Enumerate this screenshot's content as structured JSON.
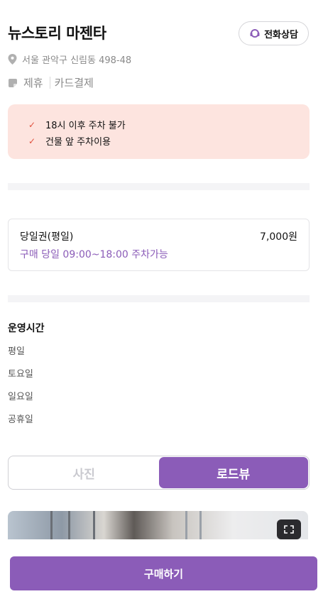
{
  "header": {
    "title": "뉴스토리 마젠타",
    "call_button_label": "전화상담"
  },
  "info": {
    "address": "서울 관악구 신림동 498-48",
    "tags": [
      "제휴",
      "카드결제"
    ]
  },
  "notice": {
    "items": [
      "18시 이후 주차 불가",
      "건물 앞 주차이용"
    ]
  },
  "ticket": {
    "name": "당일권(평일)",
    "price": "7,000원",
    "description": "구매 당일 09:00~18:00 주차가능"
  },
  "hours": {
    "title": "운영시간",
    "days": [
      "평일",
      "토요일",
      "일요일",
      "공휴일"
    ]
  },
  "view_toggle": {
    "options": [
      "사진",
      "로드뷰"
    ],
    "selected": "로드뷰"
  },
  "footer": {
    "buy_label": "구매하기"
  },
  "colors": {
    "accent": "#8b5cb8",
    "notice_bg": "#fde4df",
    "check": "#e0523f"
  },
  "icons": [
    "phone-headset-icon",
    "map-pin-icon",
    "card-tag-icon",
    "check-icon",
    "expand-icon"
  ]
}
